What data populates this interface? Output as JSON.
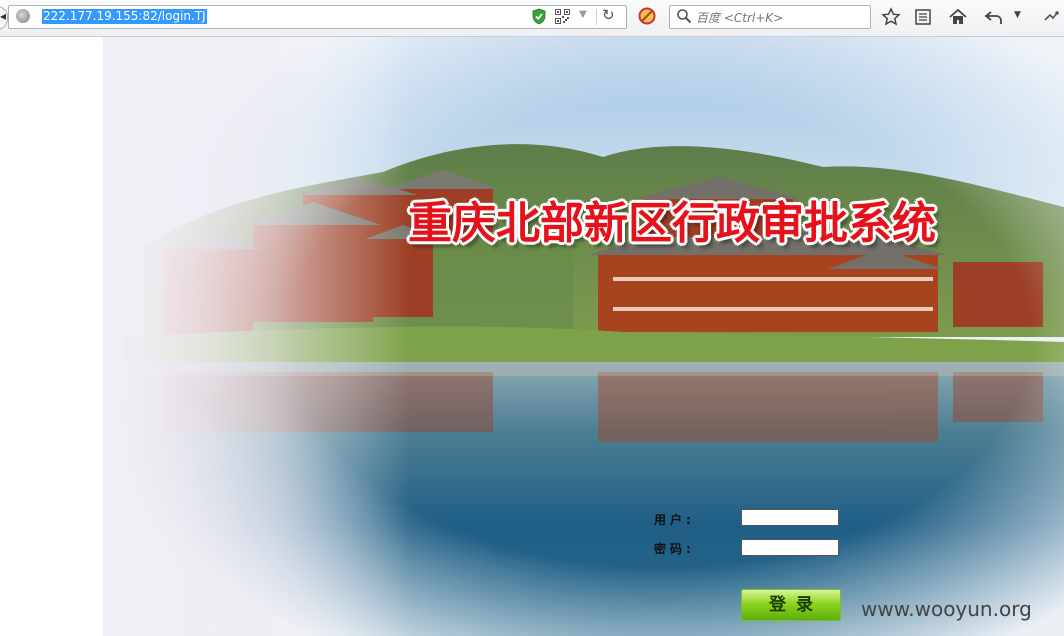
{
  "browser": {
    "url": "222.177.19.155:82/login.TJ",
    "search_placeholder": "百度 <Ctrl+K>"
  },
  "page": {
    "title": "重庆北部新区行政审批系统",
    "username_label": "用户:",
    "password_label": "密码:",
    "username_value": "",
    "password_value": "",
    "login_button": "登录",
    "watermark": "www.wooyun.org"
  },
  "colors": {
    "title_red": "#e5121b",
    "button_green": "#8fd31e",
    "url_highlight": "#3399ff"
  }
}
